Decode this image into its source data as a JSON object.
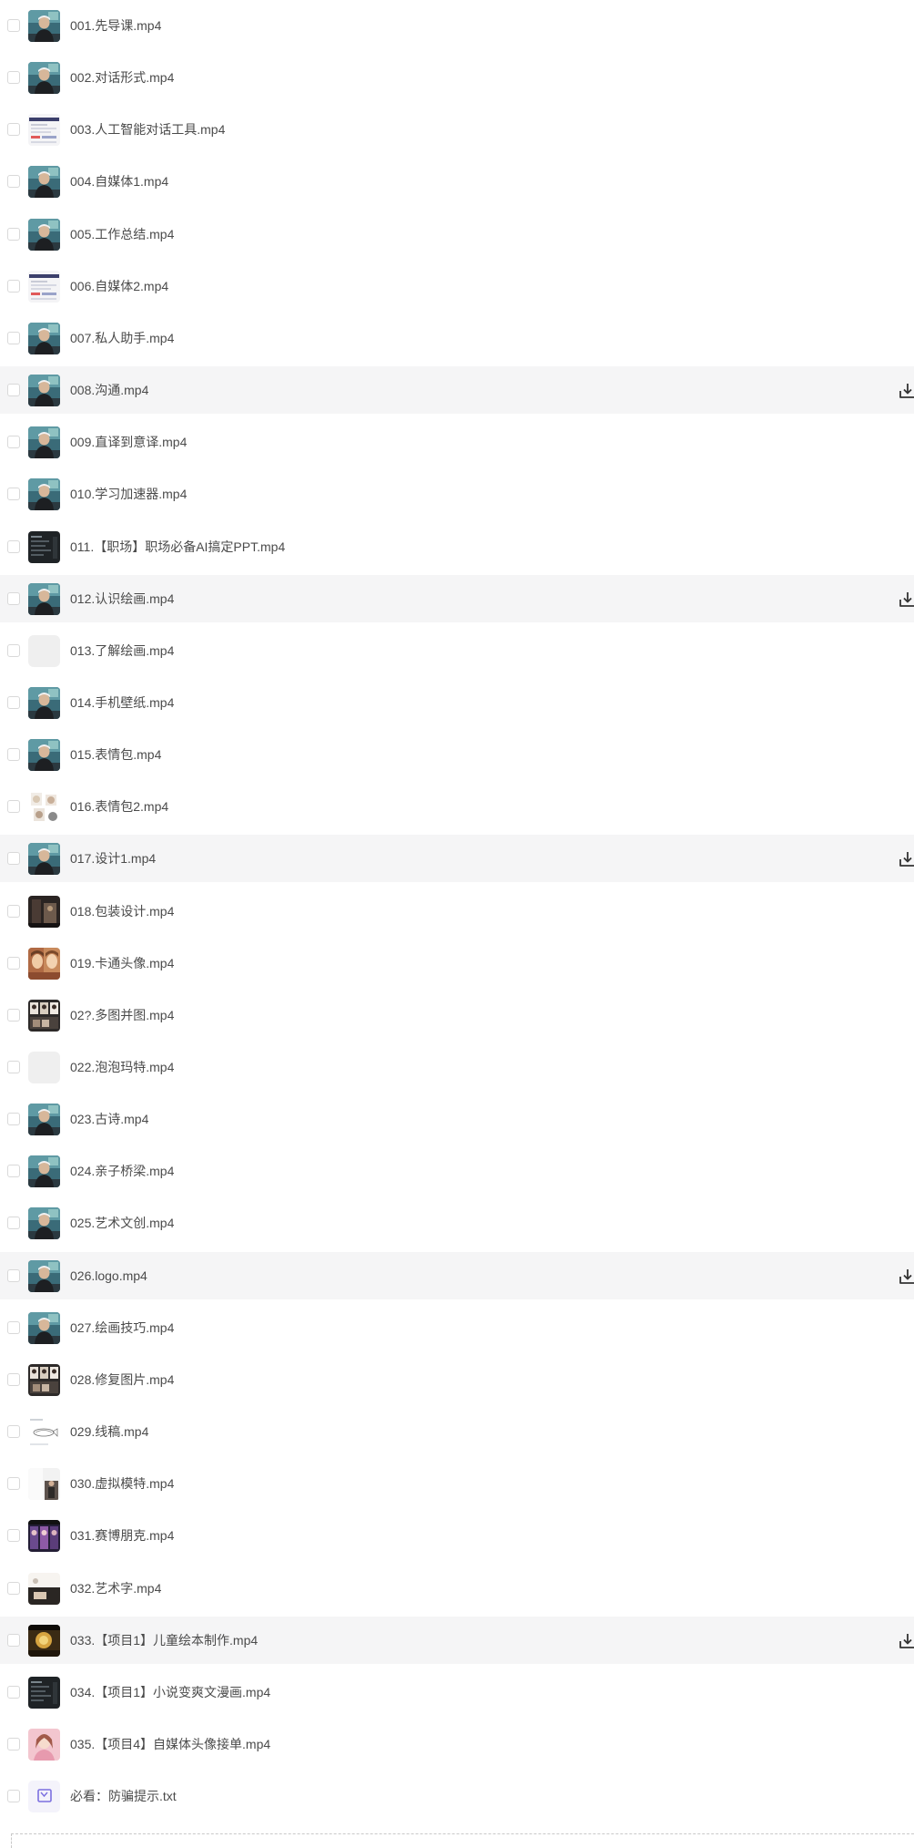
{
  "files": [
    {
      "name": "001.先导课.mp4",
      "thumb": "video-person-icon",
      "highlighted": false
    },
    {
      "name": "002.对话形式.mp4",
      "thumb": "video-person-icon",
      "highlighted": false
    },
    {
      "name": "003.人工智能对话工具.mp4",
      "thumb": "screen-doc-icon",
      "highlighted": false
    },
    {
      "name": "004.自媒体1.mp4",
      "thumb": "video-person-icon",
      "highlighted": false
    },
    {
      "name": "005.工作总结.mp4",
      "thumb": "video-person-icon",
      "highlighted": false
    },
    {
      "name": "006.自媒体2.mp4",
      "thumb": "screen-doc-icon",
      "highlighted": false
    },
    {
      "name": "007.私人助手.mp4",
      "thumb": "video-person-icon",
      "highlighted": false
    },
    {
      "name": "008.沟通.mp4",
      "thumb": "video-person-icon",
      "highlighted": true
    },
    {
      "name": "009.直译到意译.mp4",
      "thumb": "video-person-icon",
      "highlighted": false
    },
    {
      "name": "010.学习加速器.mp4",
      "thumb": "video-person-icon",
      "highlighted": false
    },
    {
      "name": "011.【职场】职场必备AI搞定PPT.mp4",
      "thumb": "dark-screen-icon",
      "highlighted": false
    },
    {
      "name": "012.认识绘画.mp4",
      "thumb": "video-person-icon",
      "highlighted": true
    },
    {
      "name": "013.了解绘画.mp4",
      "thumb": "blank-thumb-icon",
      "highlighted": false
    },
    {
      "name": "014.手机壁纸.mp4",
      "thumb": "video-person-icon",
      "highlighted": false
    },
    {
      "name": "015.表情包.mp4",
      "thumb": "video-person-icon",
      "highlighted": false
    },
    {
      "name": "016.表情包2.mp4",
      "thumb": "sticker-icon",
      "highlighted": false
    },
    {
      "name": "017.设计1.mp4",
      "thumb": "video-person-icon",
      "highlighted": true
    },
    {
      "name": "018.包装设计.mp4",
      "thumb": "dark-photo-icon",
      "highlighted": false
    },
    {
      "name": "019.卡通头像.mp4",
      "thumb": "portrait-warm-icon",
      "highlighted": false
    },
    {
      "name": "02?.多图并图.mp4",
      "thumb": "collage-icon",
      "highlighted": false
    },
    {
      "name": "022.泡泡玛特.mp4",
      "thumb": "blank-thumb-icon",
      "highlighted": false
    },
    {
      "name": "023.古诗.mp4",
      "thumb": "video-person-icon",
      "highlighted": false
    },
    {
      "name": "024.亲子桥梁.mp4",
      "thumb": "video-person-icon",
      "highlighted": false
    },
    {
      "name": "025.艺术文创.mp4",
      "thumb": "video-person-icon",
      "highlighted": false
    },
    {
      "name": "026.logo.mp4",
      "thumb": "video-person-icon",
      "highlighted": true
    },
    {
      "name": "027.绘画技巧.mp4",
      "thumb": "video-person-icon",
      "highlighted": false
    },
    {
      "name": "028.修复图片.mp4",
      "thumb": "collage-icon",
      "highlighted": false
    },
    {
      "name": "029.线稿.mp4",
      "thumb": "sketch-icon",
      "highlighted": false
    },
    {
      "name": "030.虚拟模特.mp4",
      "thumb": "model-icon",
      "highlighted": false
    },
    {
      "name": "031.赛博朋克.mp4",
      "thumb": "purple-collage-icon",
      "highlighted": false
    },
    {
      "name": "032.艺术字.mp4",
      "thumb": "art-text-icon",
      "highlighted": false
    },
    {
      "name": "033.【项目1】儿童绘本制作.mp4",
      "thumb": "golden-scene-icon",
      "highlighted": true
    },
    {
      "name": "034.【项目1】小说变爽文漫画.mp4",
      "thumb": "dark-screen-icon",
      "highlighted": false
    },
    {
      "name": "035.【项目4】自媒体头像接单.mp4",
      "thumb": "pink-portrait-icon",
      "highlighted": false
    },
    {
      "name": "必看：防骗提示.txt",
      "thumb": "txt-file-icon",
      "highlighted": false
    }
  ]
}
